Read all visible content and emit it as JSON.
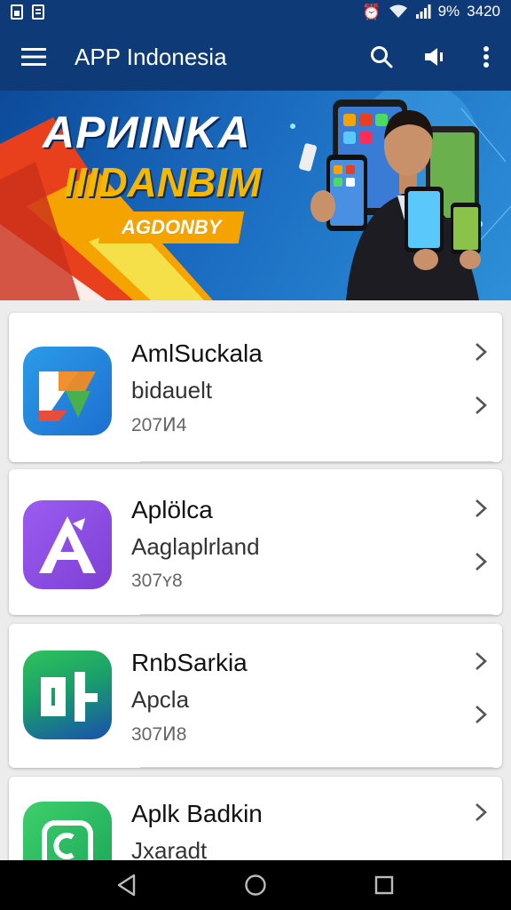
{
  "status_bar": {
    "battery": "9%",
    "time": "3420"
  },
  "app_bar": {
    "title": "APP Indonesia"
  },
  "banner": {
    "headline": "APИINKA",
    "subheadline": "IIIDANBIM",
    "badge": "AGDONBY"
  },
  "apps": [
    {
      "name": "AmlSuckala",
      "desc": "bidauelt",
      "meta": "207Ͷ4"
    },
    {
      "name": "Aplölca",
      "desc": "Aaglaplrland",
      "meta": "307ʏ8"
    },
    {
      "name": "RnbSarkia",
      "desc": "Apcla",
      "meta": "307Ͷ8"
    },
    {
      "name": "Aplk Badkin",
      "desc": "Jxaradt",
      "meta": ""
    }
  ],
  "colors": {
    "primary": "#0e3a78",
    "accent": "#f5a300"
  }
}
